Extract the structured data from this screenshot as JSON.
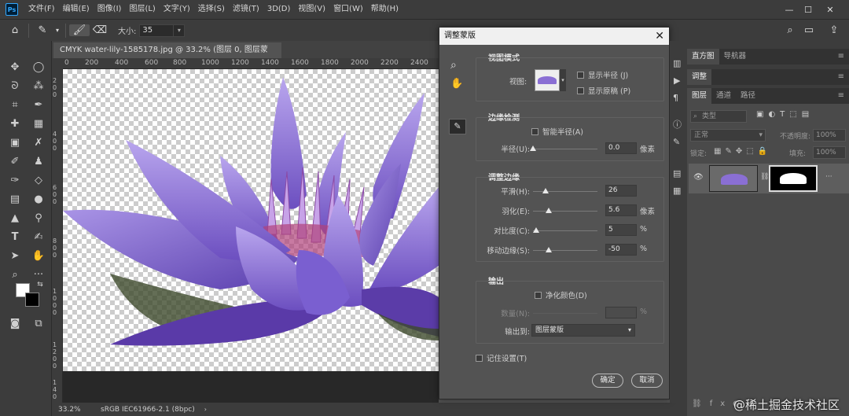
{
  "app": {
    "logo": "Ps"
  },
  "menu": [
    "文件(F)",
    "编辑(E)",
    "图像(I)",
    "图层(L)",
    "文字(Y)",
    "选择(S)",
    "滤镜(T)",
    "3D(D)",
    "视图(V)",
    "窗口(W)",
    "帮助(H)"
  ],
  "options": {
    "size_label": "大小:",
    "size_value": "35"
  },
  "document": {
    "tab_title": "CMYK water-lily-1585178.jpg @ 33.2% (图层 0, 图层蒙版/8) *",
    "ruler_h": [
      "0",
      "200",
      "400",
      "600",
      "800",
      "1000",
      "1200",
      "1400",
      "1600",
      "1800",
      "2000",
      "2200",
      "2400"
    ],
    "ruler_v": [
      "2",
      "0",
      "0",
      "4",
      "0",
      "0",
      "6",
      "0",
      "0",
      "8",
      "0",
      "0",
      "1",
      "0",
      "0",
      "0",
      "1",
      "2",
      "0",
      "0",
      "1",
      "4",
      "0",
      "0"
    ],
    "zoom": "33.2%",
    "profile": "sRGB IEC61966-2.1 (8bpc)"
  },
  "dialog": {
    "title": "调整蒙版",
    "view_mode": {
      "title": "视图模式",
      "view_label": "视图:",
      "show_radius": "显示半径 (J)",
      "show_original": "显示原稿 (P)"
    },
    "edge_detection": {
      "title": "边缘检测",
      "smart_radius": "智能半径(A)",
      "radius_label": "半径(U):",
      "radius_value": "0.0",
      "radius_unit": "像素"
    },
    "adjust_edge": {
      "title": "调整边缘",
      "rows": [
        {
          "label": "平滑(H):",
          "value": "26",
          "unit": "",
          "pos": 0.2
        },
        {
          "label": "羽化(E):",
          "value": "5.6",
          "unit": "像素",
          "pos": 0.24
        },
        {
          "label": "对比度(C):",
          "value": "5",
          "unit": "%",
          "pos": 0.05
        },
        {
          "label": "移动边缘(S):",
          "value": "-50",
          "unit": "%",
          "pos": 0.24
        }
      ]
    },
    "output": {
      "title": "输出",
      "decontaminate": "净化颜色(D)",
      "amount_label": "数量(N):",
      "amount_unit": "%",
      "output_to_label": "输出到:",
      "output_to_value": "图层蒙版"
    },
    "remember": "记住设置(T)",
    "ok": "确定",
    "cancel": "取消"
  },
  "panels": {
    "top_tabs": [
      "直方图",
      "导航器"
    ],
    "adjust_tab": "调整",
    "layer_tabs": [
      "图层",
      "通道",
      "路径"
    ],
    "kind_placeholder": "类型",
    "blend_mode": "正常",
    "opacity_label": "不透明度:",
    "opacity_value": "100%",
    "lock_label": "锁定:",
    "fill_label": "填充:",
    "fill_value": "100%"
  },
  "watermark": "@稀土掘金技术社区",
  "colors": {
    "accent": "#31a8ff",
    "lily": "#8a6fd4"
  }
}
